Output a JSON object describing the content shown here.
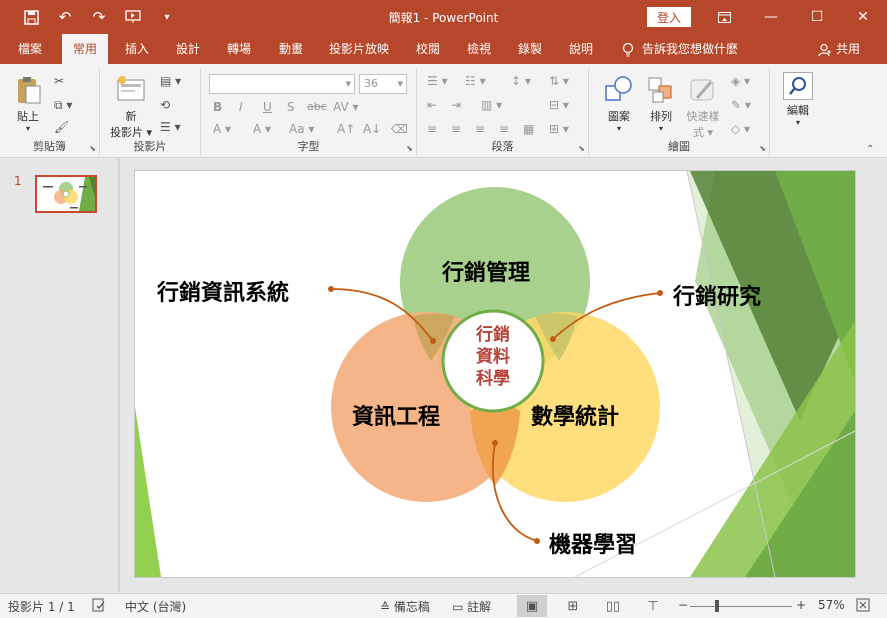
{
  "app": {
    "document_title": "簡報1 - PowerPoint",
    "login_label": "登入"
  },
  "tabs": [
    "檔案",
    "常用",
    "插入",
    "設計",
    "轉場",
    "動畫",
    "投影片放映",
    "校閱",
    "檢視",
    "錄製",
    "說明"
  ],
  "active_tab": "常用",
  "tell_me": "告訴我您想做什麼",
  "share_label": "共用",
  "ribbon": {
    "clipboard": {
      "label": "剪貼簿",
      "paste": "貼上"
    },
    "slides": {
      "label": "投影片",
      "new_slide_line1": "新",
      "new_slide_line2": "投影片"
    },
    "font": {
      "label": "字型",
      "size": "36"
    },
    "paragraph": {
      "label": "段落"
    },
    "drawing": {
      "label": "繪圖",
      "shapes": "圖案",
      "arrange": "排列",
      "quick_styles_line1": "快速樣",
      "quick_styles_line2": "式"
    },
    "editing": {
      "label": "編輯",
      "edit": "編輯"
    }
  },
  "thumbnail": {
    "slide_number": "1"
  },
  "slide": {
    "circles": {
      "top": "行銷管理",
      "left": "資訊工程",
      "right": "數學統計",
      "center": [
        "行銷",
        "資料",
        "科學"
      ]
    },
    "callouts": {
      "mis": "行銷資訊系統",
      "research": "行銷研究",
      "ml": "機器學習"
    },
    "colors": {
      "top_circle": "#a9d18e",
      "left_circle": "#f4b183",
      "right_circle": "#ffd966",
      "center_ring": "#70ad47",
      "center_text": "#b5433a",
      "callout_line": "#c55a11",
      "green_dark": "#548235",
      "green_light": "#92d050"
    }
  },
  "status": {
    "slide_info": "投影片 1 / 1",
    "language": "中文 (台灣)",
    "notes": "備忘稿",
    "comments": "註解",
    "zoom": "57%",
    "zoom_level_percent": 57
  }
}
